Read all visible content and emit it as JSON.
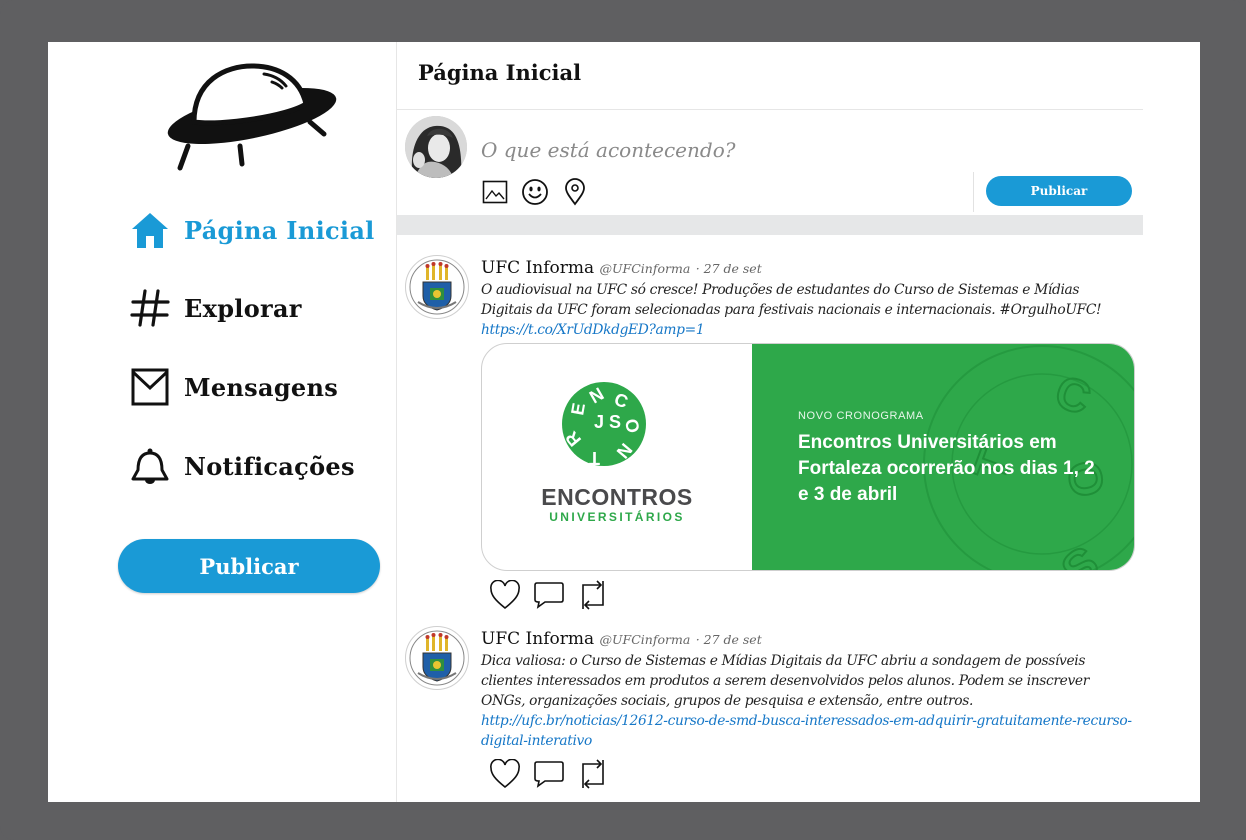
{
  "sidebar": {
    "logo_icon": "ufo-logo",
    "nav": [
      {
        "label": "Página Inicial",
        "icon": "home-icon",
        "active": true
      },
      {
        "label": "Explorar",
        "icon": "hashtag-icon"
      },
      {
        "label": "Mensagens",
        "icon": "envelope-icon"
      },
      {
        "label": "Notificações",
        "icon": "bell-icon"
      }
    ],
    "publish_label": "Publicar"
  },
  "header": {
    "title": "Página Inicial"
  },
  "compose": {
    "placeholder": "O que está acontecendo?",
    "icons": [
      "image-icon",
      "emoji-icon",
      "location-icon"
    ],
    "publish_label": "Publicar"
  },
  "tweets": [
    {
      "name": "UFC Informa",
      "handle": "@UFCinforma",
      "date": "· 27 de set",
      "text": "O audiovisual na UFC só cresce! Produções de estudantes do Curso de Sistemas e Mídias Digitais da UFC foram selecionadas para festivais nacionais e internacionais. #OrgulhoUFC!",
      "link": "https://t.co/XrUdDkdgED?amp=1",
      "card": {
        "brand": "ENCONTROS",
        "brand_sub": "UNIVERSITÁRIOS",
        "kicker": "NOVO CRONOGRAMA",
        "title": "Encontros Universitários em Fortaleza ocorrerão nos dias 1, 2 e 3 de abril"
      }
    },
    {
      "name": "UFC Informa",
      "handle": "@UFCinforma",
      "date": "· 27 de set",
      "text": "Dica valiosa: o Curso de Sistemas e Mídias Digitais da UFC abriu a sondagem de possíveis clientes interessados em produtos a serem desenvolvidos pelos alunos. Podem se inscrever ONGs, organizações sociais, grupos de pesquisa e extensão, entre outros.",
      "link": "http://ufc.br/noticias/12612-curso-de-smd-busca-interessados-em-adquirir-gratuitamente-recurso-digital-interativo"
    }
  ],
  "tweet_actions": [
    "heart-icon",
    "reply-icon",
    "retweet-icon"
  ],
  "colors": {
    "accent": "#1a9ad6",
    "card_green": "#2ea84a",
    "frame": "#5f5f61"
  }
}
